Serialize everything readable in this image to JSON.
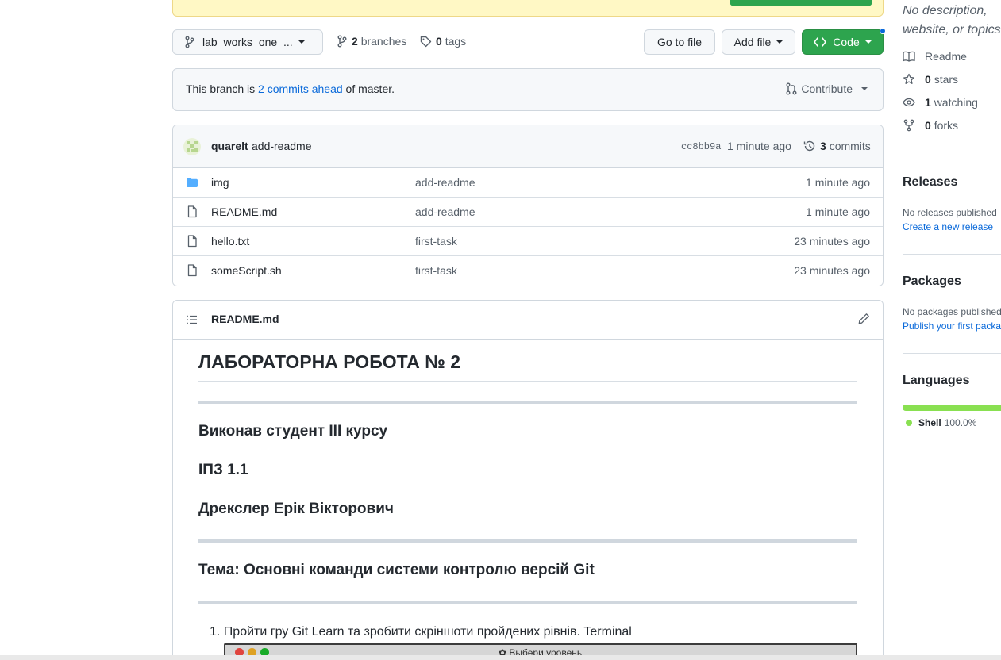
{
  "toolbar": {
    "branch_name": "lab_works_one_...",
    "branches_count": "2",
    "branches_label": "branches",
    "tags_count": "0",
    "tags_label": "tags",
    "go_to_file": "Go to file",
    "add_file": "Add file",
    "code": "Code"
  },
  "ahead": {
    "prefix": "This branch is",
    "link": "2 commits ahead",
    "suffix": "of master.",
    "contribute": "Contribute"
  },
  "latest_commit": {
    "author": "quarelt",
    "message": "add-readme",
    "sha": "cc8bb9a",
    "age": "1 minute ago",
    "commits_count": "3",
    "commits_label": "commits"
  },
  "files": [
    {
      "type": "folder",
      "name": "img",
      "message": "add-readme",
      "age": "1 minute ago"
    },
    {
      "type": "file",
      "name": "README.md",
      "message": "add-readme",
      "age": "1 minute ago"
    },
    {
      "type": "file",
      "name": "hello.txt",
      "message": "first-task",
      "age": "23 minutes ago"
    },
    {
      "type": "file",
      "name": "someScript.sh",
      "message": "first-task",
      "age": "23 minutes ago"
    }
  ],
  "readme": {
    "filename": "README.md",
    "title": "ЛАБОРАТОРНА РОБОТА № 2",
    "student": "Виконав студент III курсу",
    "group": "ІПЗ 1.1",
    "name": "Дрекслер Ерік Вікторович",
    "topic": "Тема: Основні команди системи контролю версій Git",
    "list_item_1": "1. Пройти гру Git Learn та зробити скріншоти пройдених рівнів. Terminal",
    "image_caption": "✿ Выбери уровень"
  },
  "sidebar": {
    "description": "No description, website, or topics provided.",
    "readme": "Readme",
    "stars_count": "0",
    "stars_label": "stars",
    "watching_count": "1",
    "watching_label": "watching",
    "forks_count": "0",
    "forks_label": "forks",
    "releases_title": "Releases",
    "releases_text": "No releases published",
    "releases_link": "Create a new release",
    "packages_title": "Packages",
    "packages_text": "No packages published",
    "packages_link": "Publish your first package",
    "languages_title": "Languages",
    "language_name": "Shell",
    "language_percent": "100.0%",
    "language_color": "#89e051"
  },
  "colors": {
    "accent": "#0969da",
    "green": "#2da44e",
    "folder": "#54aeff"
  }
}
